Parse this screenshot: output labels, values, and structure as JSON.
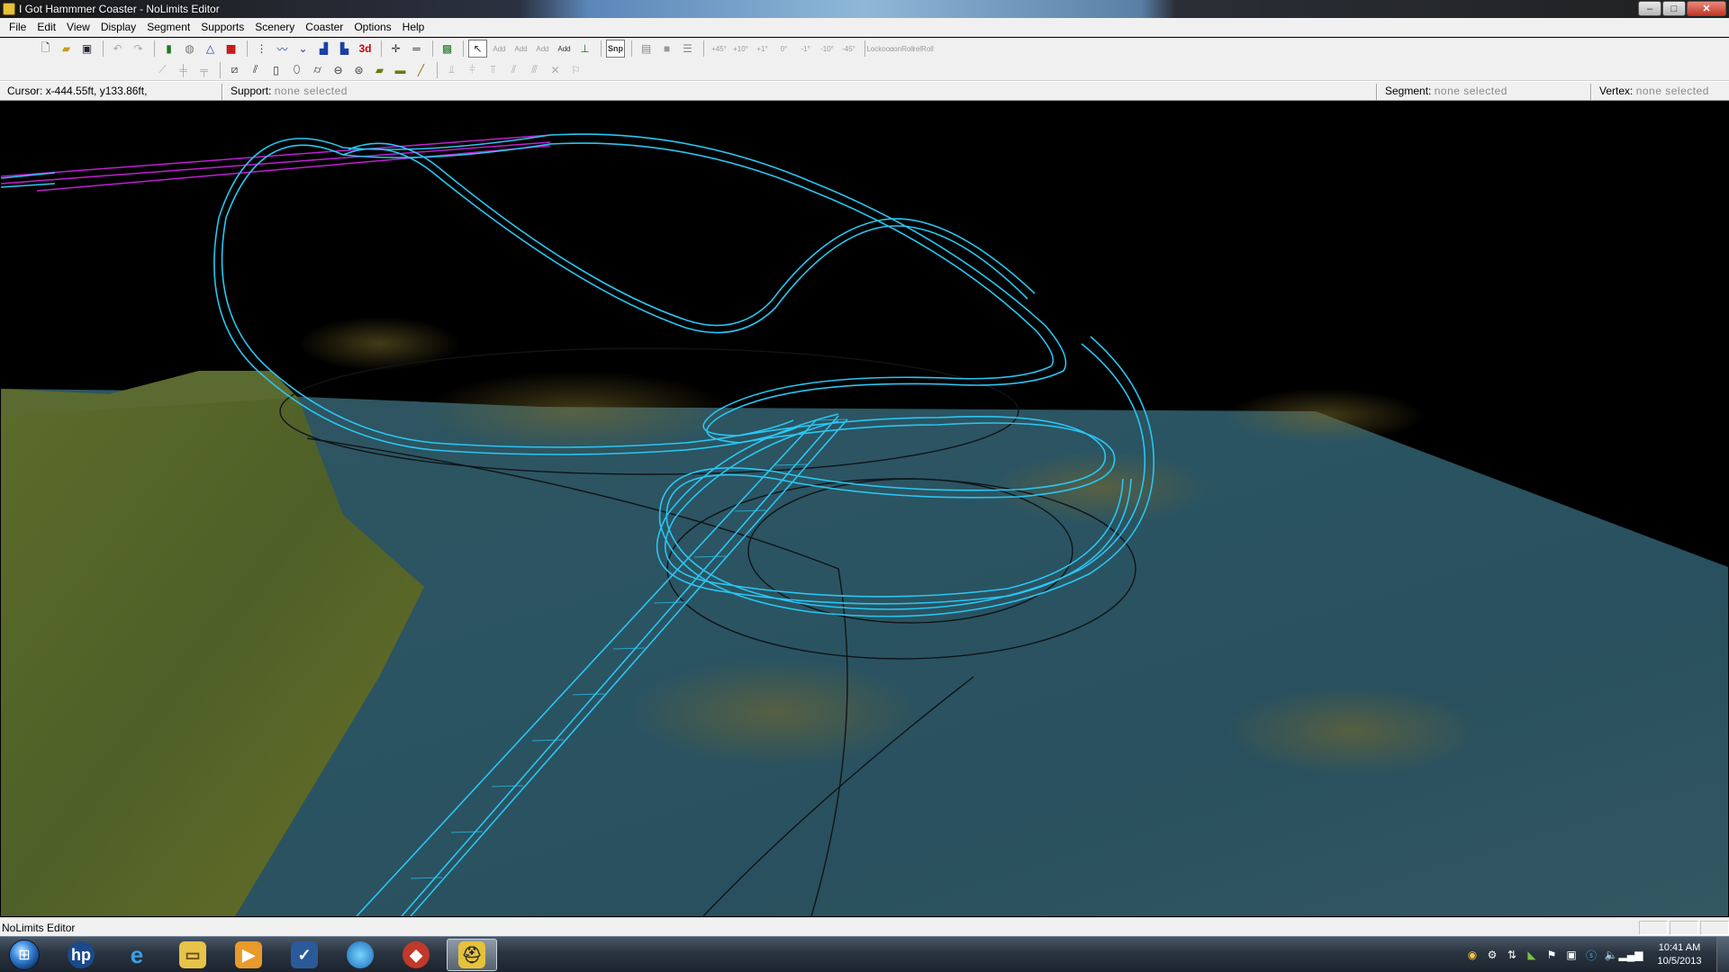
{
  "window": {
    "title": "I Got Hammmer Coaster - NoLimits Editor",
    "controls": {
      "minimize": "–",
      "maximize": "□",
      "close": "✕"
    }
  },
  "menu": [
    "File",
    "Edit",
    "View",
    "Display",
    "Segment",
    "Supports",
    "Scenery",
    "Coaster",
    "Options",
    "Help"
  ],
  "toolbar": {
    "snap_label": "Snp",
    "mode_3d_label": "3d",
    "angle_buttons": [
      "+45°",
      "+10°",
      "+1°",
      "0°",
      "-1°",
      "-10°",
      "-45°"
    ],
    "roll_buttons": [
      [
        "Lock",
        "ooo"
      ],
      [
        "con",
        "Roll"
      ],
      [
        "rel",
        "Roll"
      ]
    ],
    "add_buttons": [
      "Add",
      "Add",
      "Add",
      "Add"
    ]
  },
  "info": {
    "cursor_label": "Cursor:",
    "cursor_value": "x-444.55ft, y133.86ft,",
    "support_label": "Support:",
    "support_value": "none selected",
    "segment_label": "Segment:",
    "segment_value": "none selected",
    "vertex_label": "Vertex:",
    "vertex_value": "none selected"
  },
  "status": {
    "text": "NoLimits Editor"
  },
  "taskbar": {
    "clock_time": "10:41 AM",
    "clock_date": "10/5/2013",
    "apps": [
      "hp-icon",
      "internet-explorer-icon",
      "file-explorer-icon",
      "media-player-icon",
      "tasks-icon",
      "browser-globe-icon",
      "pdf-reader-icon",
      "nolimits-editor-icon"
    ]
  },
  "colors": {
    "track_cyan": "#29c6f2",
    "track_magenta": "#c020d0",
    "terrain_teal": "#2e5a66",
    "terrain_hill": "#5a6a28"
  }
}
